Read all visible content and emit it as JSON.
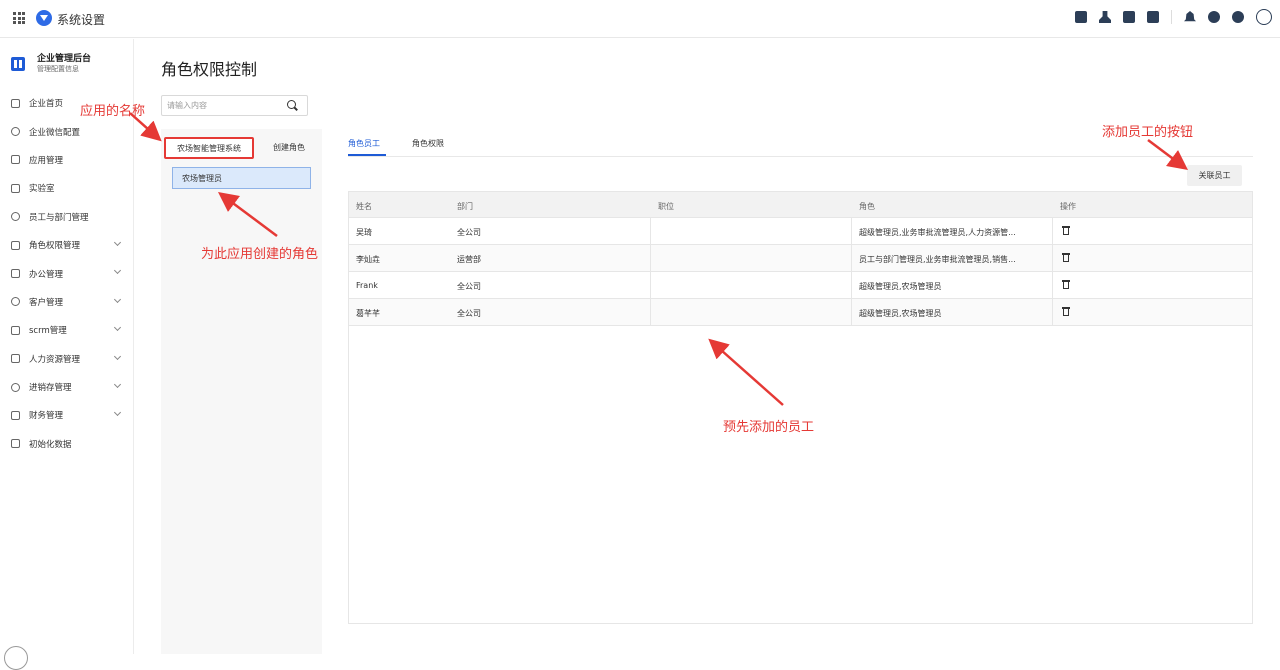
{
  "topbar": {
    "title": "系统设置",
    "icons": [
      "grid-menu-icon",
      "app-logo-icon",
      "calendar-icon",
      "user-icon",
      "document-icon",
      "phone-icon",
      "bell-icon",
      "help-icon",
      "settings-icon",
      "avatar-icon"
    ]
  },
  "sidebar": {
    "org_name": "企业管理后台",
    "org_subtitle": "管理配置信息",
    "items": [
      {
        "label": "企业首页",
        "icon": "home-icon",
        "expandable": false
      },
      {
        "label": "企业微信配置",
        "icon": "chat-icon",
        "expandable": false
      },
      {
        "label": "应用管理",
        "icon": "apps-icon",
        "expandable": false
      },
      {
        "label": "实验室",
        "icon": "lab-icon",
        "expandable": false
      },
      {
        "label": "员工与部门管理",
        "icon": "users-icon",
        "expandable": false
      },
      {
        "label": "角色权限管理",
        "icon": "role-icon",
        "expandable": true
      },
      {
        "label": "办公管理",
        "icon": "office-icon",
        "expandable": true
      },
      {
        "label": "客户管理",
        "icon": "customer-icon",
        "expandable": true
      },
      {
        "label": "scrm管理",
        "icon": "scrm-icon",
        "expandable": true
      },
      {
        "label": "人力资源管理",
        "icon": "hr-icon",
        "expandable": true
      },
      {
        "label": "进销存管理",
        "icon": "inventory-icon",
        "expandable": true
      },
      {
        "label": "财务管理",
        "icon": "finance-icon",
        "expandable": true
      },
      {
        "label": "初始化数据",
        "icon": "init-icon",
        "expandable": false
      }
    ]
  },
  "main": {
    "title": "角色权限控制",
    "search_placeholder": "请输入内容",
    "app_tab": "农场智能管理系统",
    "create_role": "创建角色",
    "roles": [
      "农场管理员"
    ],
    "tabs": [
      "角色员工",
      "角色权限"
    ],
    "active_tab": 0,
    "link_button": "关联员工",
    "table": {
      "headers": [
        "姓名",
        "部门",
        "职位",
        "角色",
        "操作"
      ],
      "rows": [
        {
          "name": "吴琦",
          "dept": "全公司",
          "position": "",
          "role": "超级管理员,业务审批流管理员,人力资源管..."
        },
        {
          "name": "李灿垚",
          "dept": "运营部",
          "position": "",
          "role": "员工与部门管理员,业务审批流管理员,销售..."
        },
        {
          "name": "Frank",
          "dept": "全公司",
          "position": "",
          "role": "超级管理员,农场管理员"
        },
        {
          "name": "葛芊芊",
          "dept": "全公司",
          "position": "",
          "role": "超级管理员,农场管理员"
        }
      ]
    }
  },
  "annotations": {
    "app_name": "应用的名称",
    "created_role": "为此应用创建的角色",
    "add_employee_button": "添加员工的按钮",
    "preadded_employees": "预先添加的员工",
    "color": "#e53935"
  }
}
